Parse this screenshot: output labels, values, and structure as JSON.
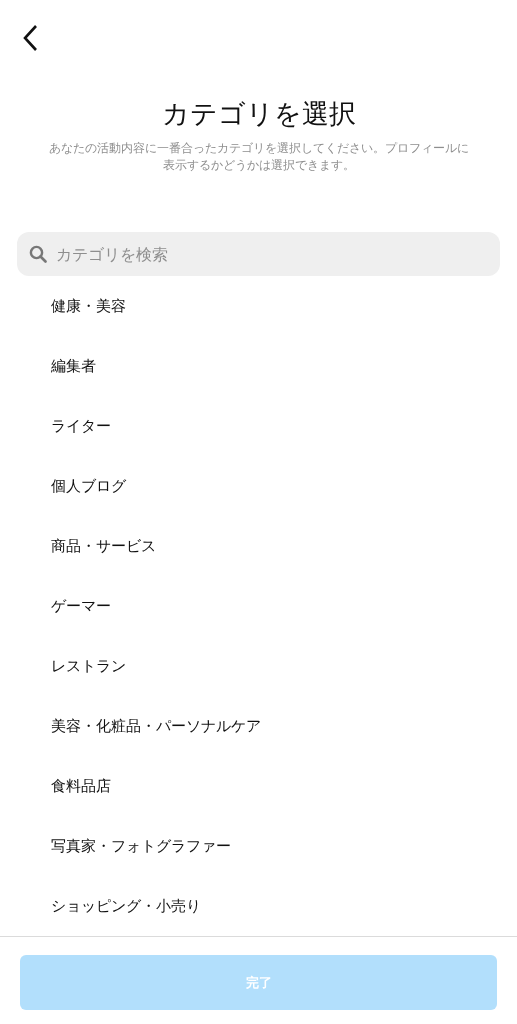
{
  "title": "カテゴリを選択",
  "description": "あなたの活動内容に一番合ったカテゴリを選択してください。プロフィールに表示するかどうかは選択できます。",
  "search": {
    "placeholder": "カテゴリを検索"
  },
  "categories": [
    {
      "label": "健康・美容"
    },
    {
      "label": "編集者"
    },
    {
      "label": "ライター"
    },
    {
      "label": "個人ブログ"
    },
    {
      "label": "商品・サービス"
    },
    {
      "label": "ゲーマー"
    },
    {
      "label": "レストラン"
    },
    {
      "label": "美容・化粧品・パーソナルケア"
    },
    {
      "label": "食料品店"
    },
    {
      "label": "写真家・フォトグラファー"
    },
    {
      "label": "ショッピング・小売り"
    }
  ],
  "done_button": {
    "label": "完了",
    "disabled": true
  }
}
